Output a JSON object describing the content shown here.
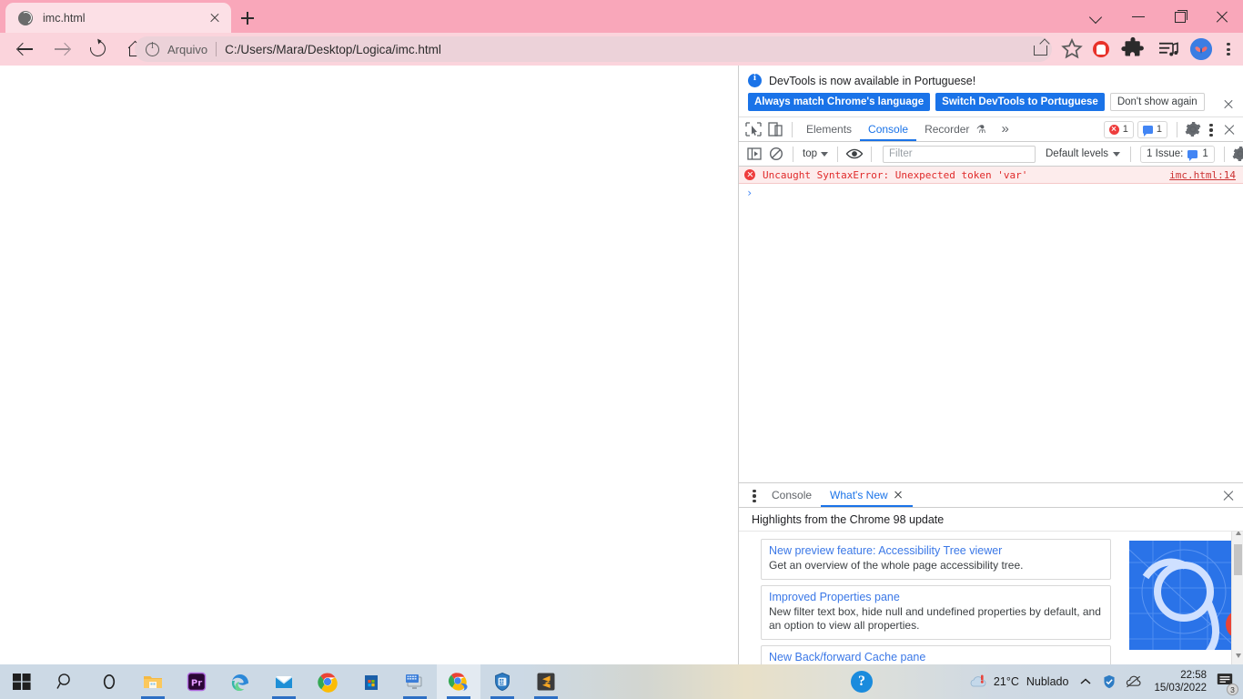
{
  "browser": {
    "tab": {
      "title": "imc.html",
      "favicon": "globe-icon",
      "close": "×"
    },
    "new_tab_label": "+",
    "window_controls": {
      "minimize": "—",
      "maximize": "□",
      "close": "×",
      "chevron": "⌄"
    },
    "nav": {
      "back": "←",
      "forward": "→",
      "reload": "⟳",
      "home": "⌂"
    },
    "address": {
      "info_icon": "info-circle-icon",
      "scheme_label": "Arquivo",
      "url": "C:/Users/Mara/Desktop/Logica/imc.html"
    },
    "toolbar_icons": [
      "share-icon",
      "bookmark-star-icon",
      "adblock-icon",
      "extensions-puzzle-icon",
      "reading-list-icon",
      "profile-avatar-icon",
      "chrome-menu-icon"
    ]
  },
  "devtools": {
    "banner": {
      "message": "DevTools is now available in Portuguese!",
      "buttons": [
        {
          "label": "Always match Chrome's language",
          "style": "primary"
        },
        {
          "label": "Switch DevTools to Portuguese",
          "style": "primary"
        },
        {
          "label": "Don't show again",
          "style": "plain"
        }
      ],
      "close": "×"
    },
    "tabs": [
      {
        "label": "Elements",
        "active": false
      },
      {
        "label": "Console",
        "active": true
      },
      {
        "label": "Recorder",
        "active": false,
        "suffix": "⚗"
      }
    ],
    "overflow": "»",
    "error_badge": "1",
    "message_badge": "1",
    "filterbar": {
      "context": "top",
      "filter_placeholder": "Filter",
      "filter_value": "",
      "levels": "Default levels",
      "issues_label": "1 Issue:",
      "issues_count": "1"
    },
    "console": {
      "error_text": "Uncaught SyntaxError: Unexpected token 'var'",
      "error_source": "imc.html:14",
      "prompt": "›"
    },
    "drawer": {
      "tabs": [
        {
          "label": "Console",
          "active": false
        },
        {
          "label": "What's New",
          "active": true,
          "closable": true
        }
      ],
      "whats_new": {
        "heading": "Highlights from the Chrome 98 update",
        "cards": [
          {
            "title": "New preview feature: Accessibility Tree viewer",
            "desc": "Get an overview of the whole page accessibility tree."
          },
          {
            "title": "Improved Properties pane",
            "desc": "New filter text box, hide null and undefined properties by default, and an option to view all properties."
          },
          {
            "title": "New Back/forward Cache pane",
            "desc": ""
          }
        ]
      }
    }
  },
  "taskbar": {
    "items": [
      {
        "name": "start-button",
        "running": false,
        "focused": false
      },
      {
        "name": "search-button",
        "running": false,
        "focused": false
      },
      {
        "name": "cortana-button",
        "running": false,
        "focused": false
      },
      {
        "name": "file-explorer",
        "running": true,
        "focused": false
      },
      {
        "name": "premiere-pro",
        "running": false,
        "focused": false
      },
      {
        "name": "microsoft-edge",
        "running": false,
        "focused": false
      },
      {
        "name": "mail",
        "running": true,
        "focused": false
      },
      {
        "name": "google-chrome",
        "running": false,
        "focused": false
      },
      {
        "name": "microsoft-store",
        "running": false,
        "focused": false
      },
      {
        "name": "remote-desktop",
        "running": true,
        "focused": false
      },
      {
        "name": "chrome-window",
        "running": true,
        "focused": true
      },
      {
        "name": "security-app",
        "running": true,
        "focused": false
      },
      {
        "name": "sublime-text",
        "running": true,
        "focused": false
      }
    ],
    "tray": {
      "help_icon": "help-circle-icon",
      "weather_temp": "21°C",
      "weather_desc": "Nublado",
      "chevron": "^",
      "shield_icon": "security-shield-icon",
      "cloud_icon": "onedrive-offline-icon",
      "time": "22:58",
      "date": "15/03/2022",
      "notification_count": "3"
    }
  },
  "colors": {
    "tabstrip": "#f9a7ba",
    "toolbar": "#fbd4dc",
    "urlbar": "#ecd2d9",
    "devtools_accent": "#1a73e8",
    "error_red": "#e02a2a",
    "taskbar": "#ccd9e5"
  }
}
